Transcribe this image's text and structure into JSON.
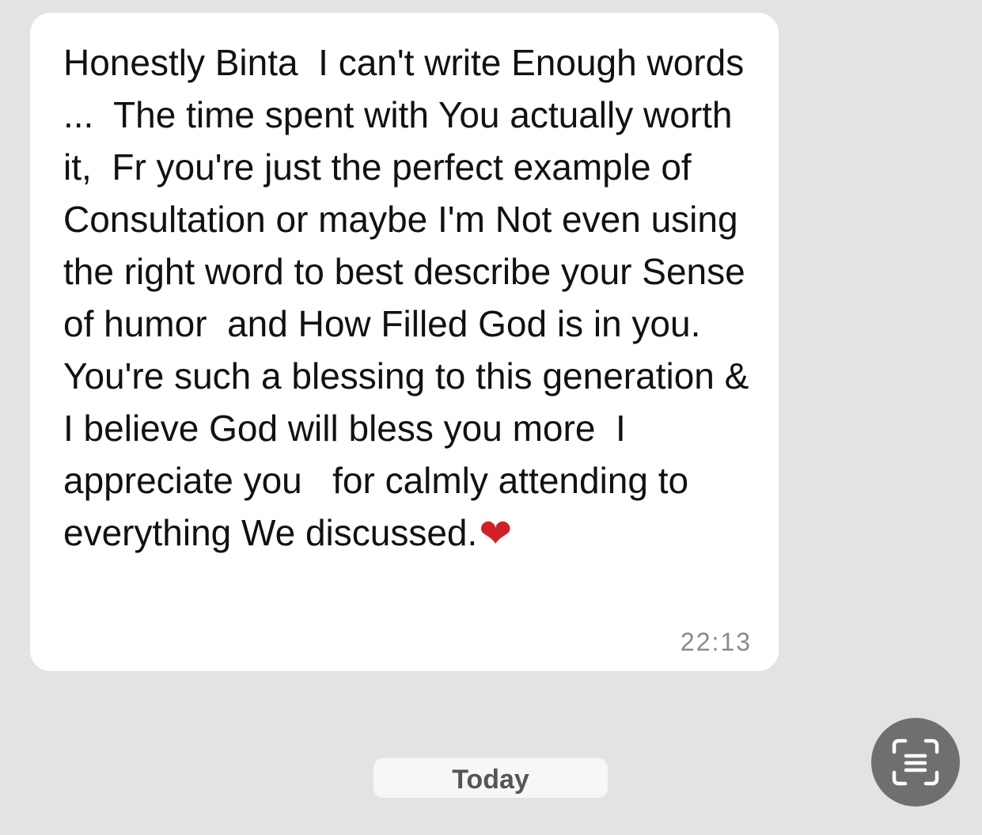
{
  "message": {
    "text": "Honestly Binta  I can't write Enough words ...  The time spent with You actually worth it,  Fr you're just the perfect example of Consultation or maybe I'm Not even using the right word to best describe your Sense of humor  and How Filled God is in you. You're such a blessing to this generation & I believe God will bless you more  I appreciate you   for calmly attending to everything We discussed.",
    "emoji": "❤",
    "time": "22:13"
  },
  "date_divider": {
    "label": "Today"
  },
  "scan_button": {
    "icon": "scan-text-icon"
  },
  "colors": {
    "background": "#e3e3e3",
    "bubble": "#ffffff",
    "heart": "#d2202a",
    "scan_button": "#6f6f6f"
  }
}
